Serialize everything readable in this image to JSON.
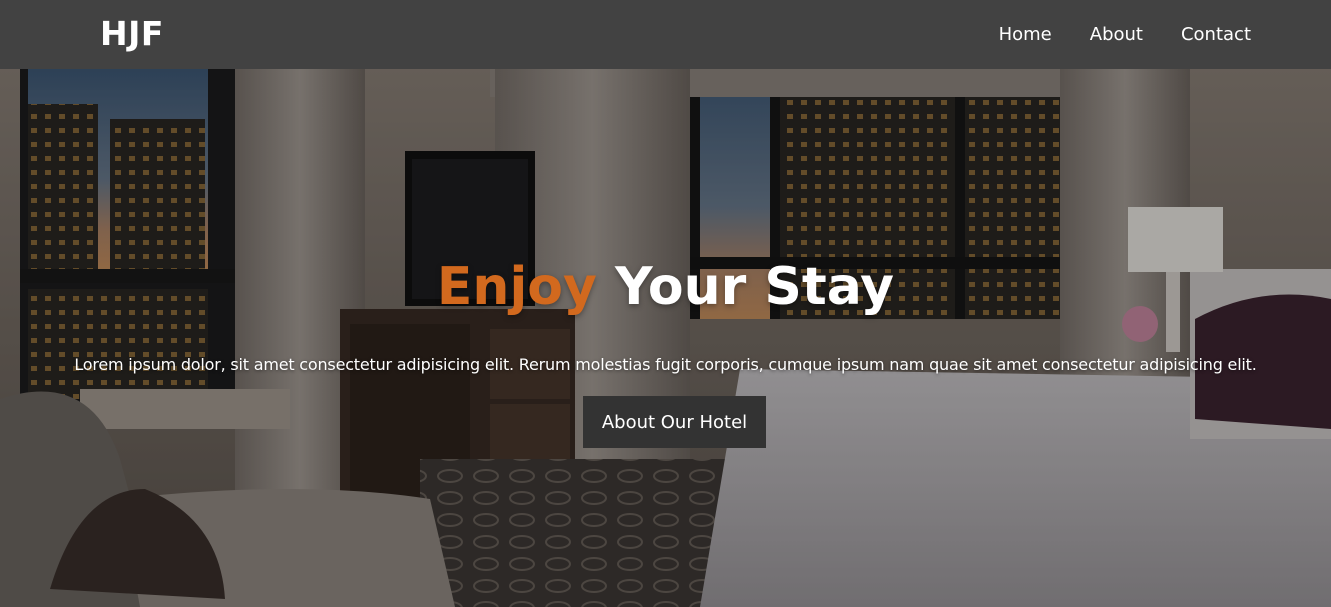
{
  "nav": {
    "brand": "HJF",
    "links": [
      {
        "label": "Home"
      },
      {
        "label": "About"
      },
      {
        "label": "Contact"
      }
    ]
  },
  "hero": {
    "title_accent": "Enjoy",
    "title_rest": " Your Stay",
    "text": "Lorem ipsum dolor, sit amet consectetur adipisicing elit. Rerum molestias fugit corporis, cumque ipsum nam quae sit amet consectetur adipisicing elit.",
    "button_label": "About Our Hotel",
    "background_image": "hotel-room-photo"
  },
  "colors": {
    "navbar_bg": "#424242",
    "accent": "#d2691e",
    "button_bg": "#333333",
    "text": "#ffffff"
  }
}
